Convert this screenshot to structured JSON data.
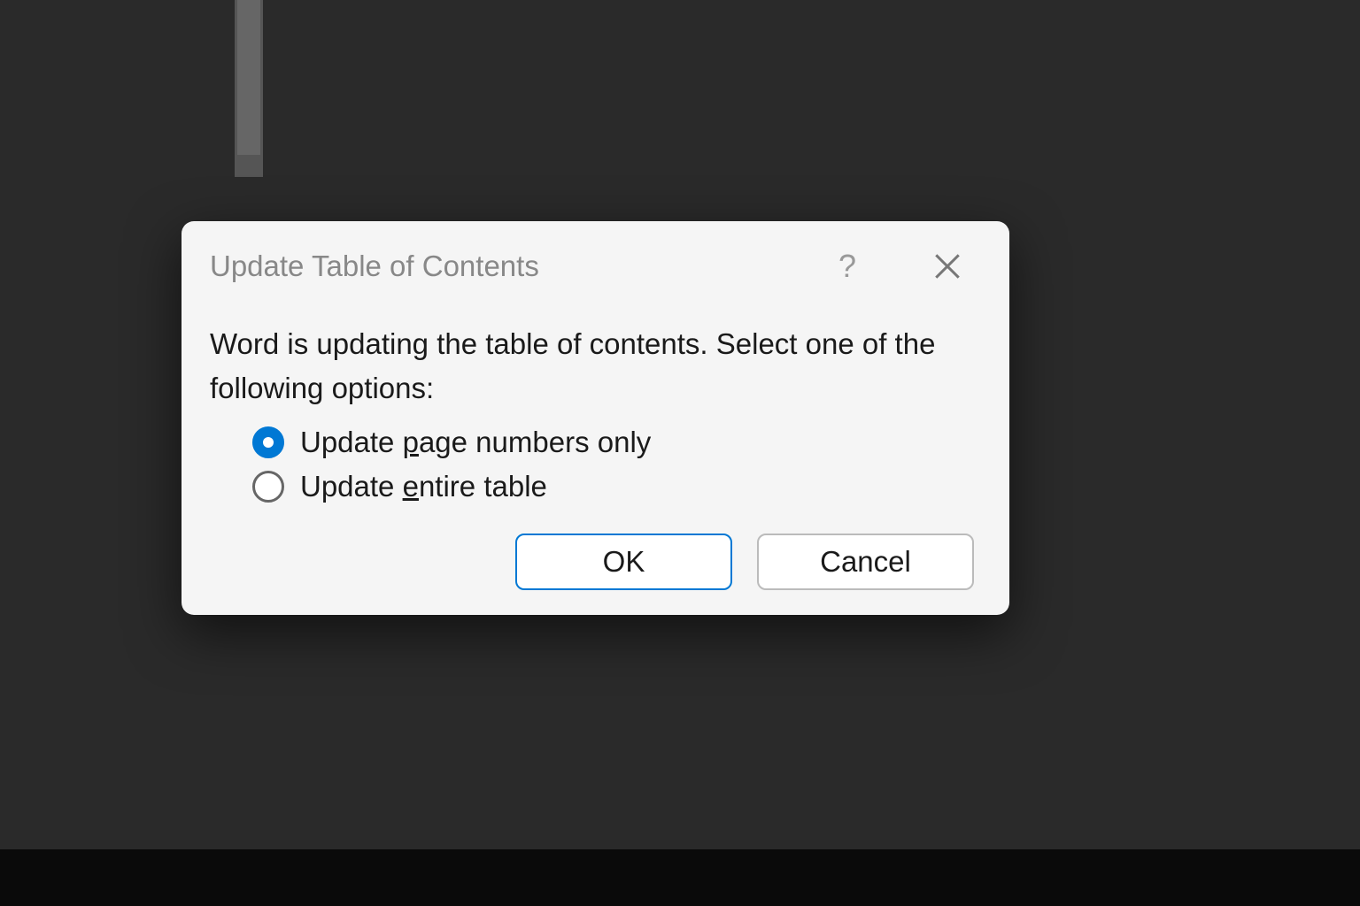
{
  "dialog": {
    "title": "Update Table of Contents",
    "message": "Word is updating the table of contents.  Select one of the following options:",
    "options": [
      {
        "label_before": "Update ",
        "accelerator": "p",
        "label_after": "age numbers only",
        "selected": true
      },
      {
        "label_before": "Update ",
        "accelerator": "e",
        "label_after": "ntire table",
        "selected": false
      }
    ],
    "buttons": {
      "ok": "OK",
      "cancel": "Cancel"
    }
  }
}
